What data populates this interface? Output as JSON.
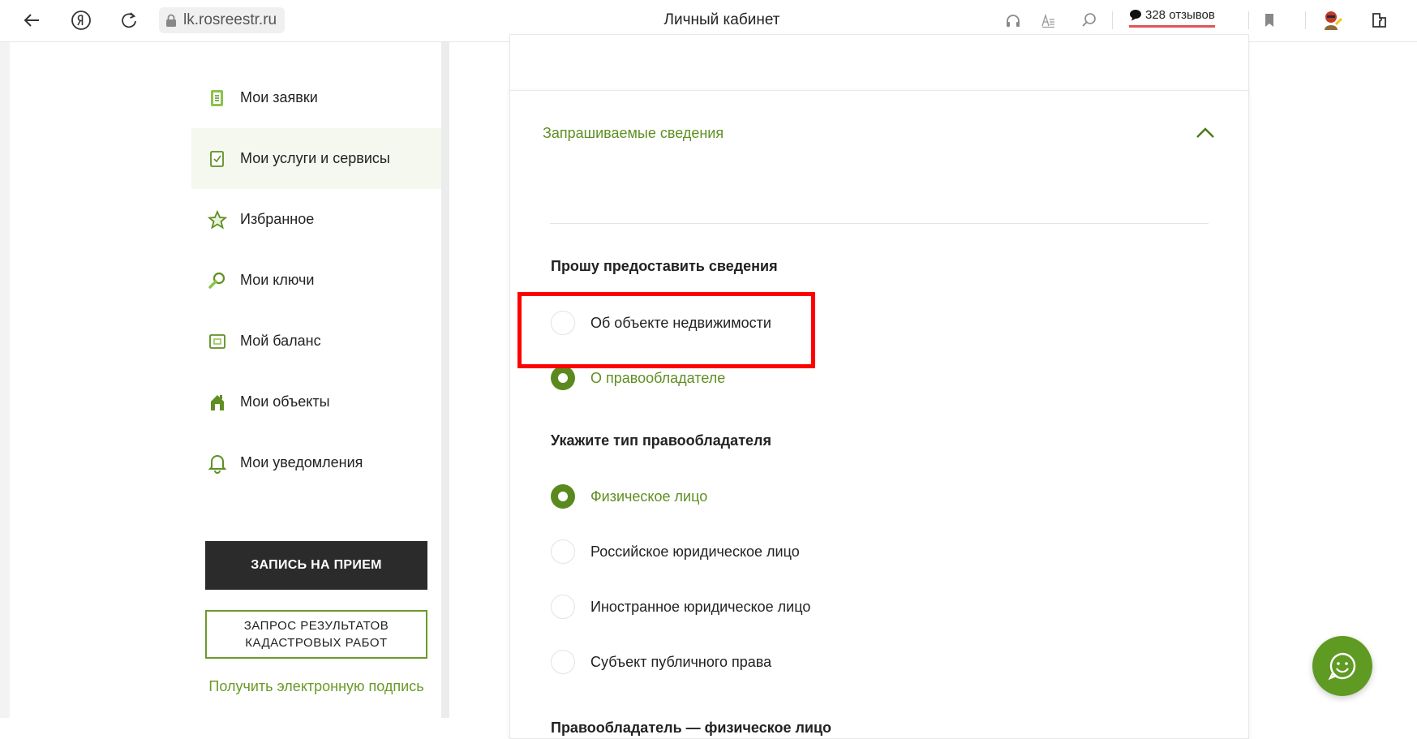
{
  "browser": {
    "url": "lk.rosreestr.ru",
    "page_title": "Личный кабинет",
    "reviews_label": "328 отзывов",
    "icons": [
      "back-icon",
      "yandex-icon",
      "reload-icon",
      "lock-icon",
      "headphones-icon",
      "reader-icon",
      "search-icon",
      "bookmark-icon",
      "profile-icon",
      "extensions-icon"
    ]
  },
  "sidebar": {
    "items": [
      {
        "label": "Мои заявки",
        "icon": "applications-icon"
      },
      {
        "label": "Мои услуги и сервисы",
        "icon": "services-icon"
      },
      {
        "label": "Избранное",
        "icon": "star-icon"
      },
      {
        "label": "Мои ключи",
        "icon": "key-icon"
      },
      {
        "label": "Мой баланс",
        "icon": "wallet-icon"
      },
      {
        "label": "Мои объекты",
        "icon": "house-icon"
      },
      {
        "label": "Мои уведомления",
        "icon": "bell-icon"
      }
    ],
    "appointment_button": "ЗАПИСЬ НА ПРИЕМ",
    "cadastral_button": "ЗАПРОС РЕЗУЛЬТАТОВ КАДАСТРОВЫХ РАБОТ",
    "signature_link": "Получить электронную подпись"
  },
  "card": {
    "header": "Запрашиваемые сведения",
    "request_section_title": "Прошу предоставить сведения",
    "request_options": [
      {
        "label": "Об объекте недвижимости",
        "checked": false
      },
      {
        "label": "О правообладателе",
        "checked": true
      }
    ],
    "holder_type_title": "Укажите тип правообладателя",
    "holder_type_options": [
      {
        "label": "Физическое лицо",
        "checked": true
      },
      {
        "label": "Российское юридическое лицо",
        "checked": false
      },
      {
        "label": "Иностранное юридическое лицо",
        "checked": false
      },
      {
        "label": "Субъект публичного права",
        "checked": false
      }
    ],
    "next_section_title": "Правообладатель — физическое лицо"
  },
  "colors": {
    "accent": "#5f8f22",
    "highlight": "#ff0000",
    "dark_button": "#2b2b2b",
    "chat_button": "#5f9a22"
  }
}
